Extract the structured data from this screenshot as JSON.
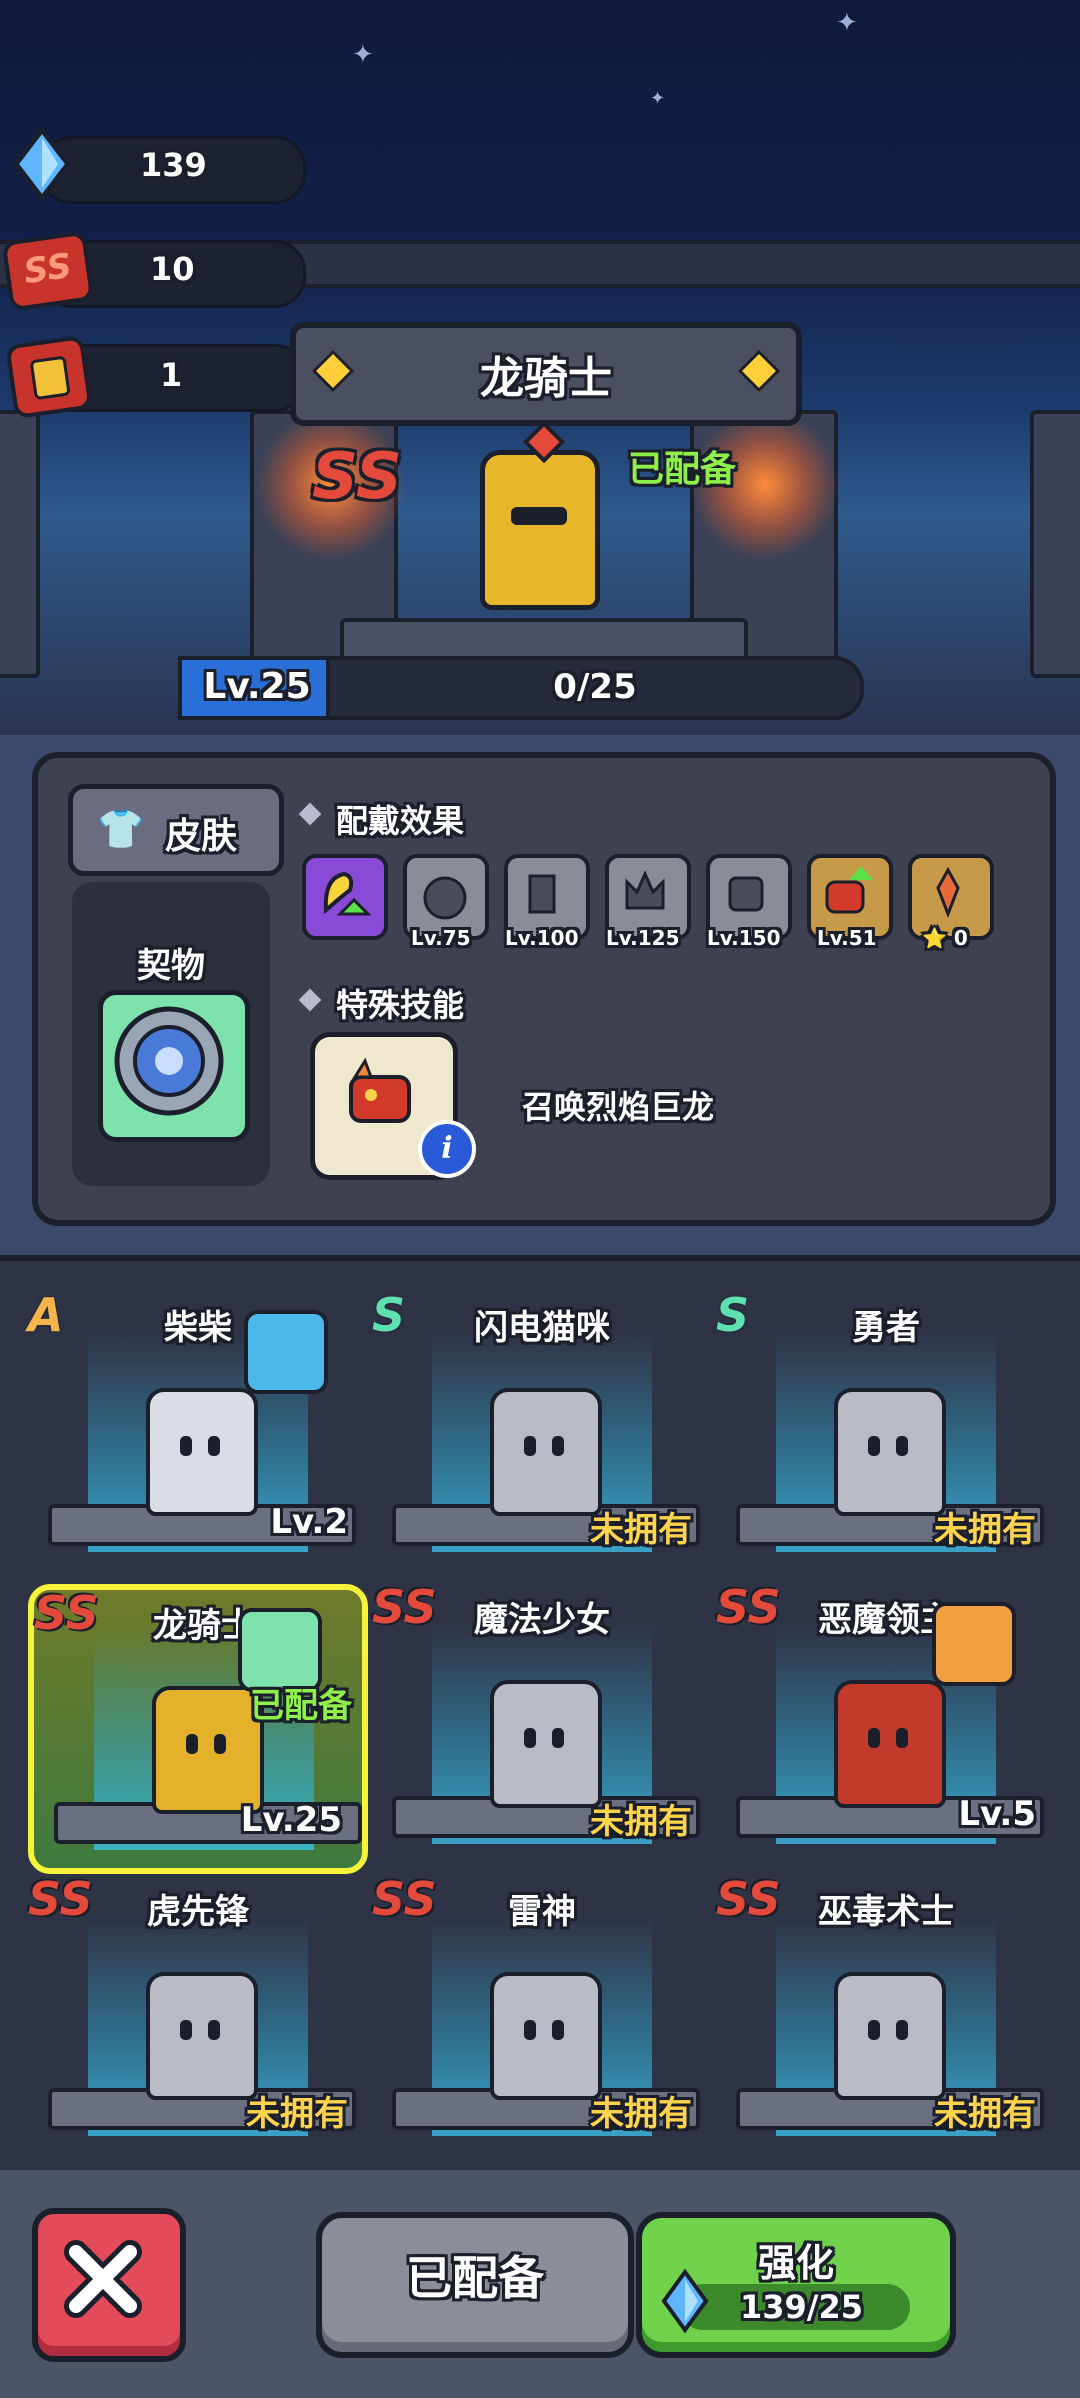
{
  "resources": {
    "gems": "139",
    "ss_tickets": "10",
    "armor_tickets": "1"
  },
  "hero": {
    "name": "龙骑士",
    "rank": "SS",
    "equipped_label": "已配备",
    "level_label": "Lv.25",
    "xp_text": "0/25"
  },
  "panel": {
    "skin_label": "皮肤",
    "pact_label": "契物",
    "effects_title": "配戴效果",
    "effects": [
      {
        "icon": "strength-up-icon",
        "label": ""
      },
      {
        "icon": "shield-icon",
        "label": "Lv.75"
      },
      {
        "icon": "boot-icon",
        "label": "Lv.100"
      },
      {
        "icon": "crown-icon",
        "label": "Lv.125"
      },
      {
        "icon": "armor-icon",
        "label": "Lv.150"
      },
      {
        "icon": "dragon-up-icon",
        "label": "Lv.51"
      },
      {
        "icon": "star-icon",
        "label": "⭐ 0"
      }
    ],
    "skill_title": "特殊技能",
    "skill_name": "召唤烈焰巨龙"
  },
  "characters": [
    {
      "rank": "A",
      "name": "柴柴",
      "status": "Lv.2",
      "owned": true,
      "badge": "pact-book-icon",
      "color": "#d9dde4"
    },
    {
      "rank": "S",
      "name": "闪电猫咪",
      "status": "未拥有",
      "owned": false,
      "badge": "",
      "color": "#b9bcc4"
    },
    {
      "rank": "S",
      "name": "勇者",
      "status": "未拥有",
      "owned": false,
      "badge": "",
      "color": "#b9bcc4"
    },
    {
      "rank": "SS",
      "name": "龙骑士",
      "status": "Lv.25",
      "owned": true,
      "badge": "pact-shield-icon",
      "equipped": "已配备",
      "color": "#e3b22a"
    },
    {
      "rank": "SS",
      "name": "魔法少女",
      "status": "未拥有",
      "owned": false,
      "badge": "",
      "color": "#b9bcc4"
    },
    {
      "rank": "SS",
      "name": "恶魔领主",
      "status": "Lv.5",
      "owned": true,
      "badge": "pact-helmet-icon",
      "color": "#c23a2c"
    },
    {
      "rank": "SS",
      "name": "虎先锋",
      "status": "未拥有",
      "owned": false,
      "badge": "",
      "color": "#b9bcc4"
    },
    {
      "rank": "SS",
      "name": "雷神",
      "status": "未拥有",
      "owned": false,
      "badge": "",
      "color": "#b9bcc4"
    },
    {
      "rank": "SS",
      "name": "巫毒术士",
      "status": "未拥有",
      "owned": false,
      "badge": "",
      "color": "#b9bcc4"
    }
  ],
  "bottom": {
    "close_icon": "close-icon",
    "equipped_button": "已配备",
    "upgrade_button": "强化",
    "upgrade_cost": "139/25"
  }
}
